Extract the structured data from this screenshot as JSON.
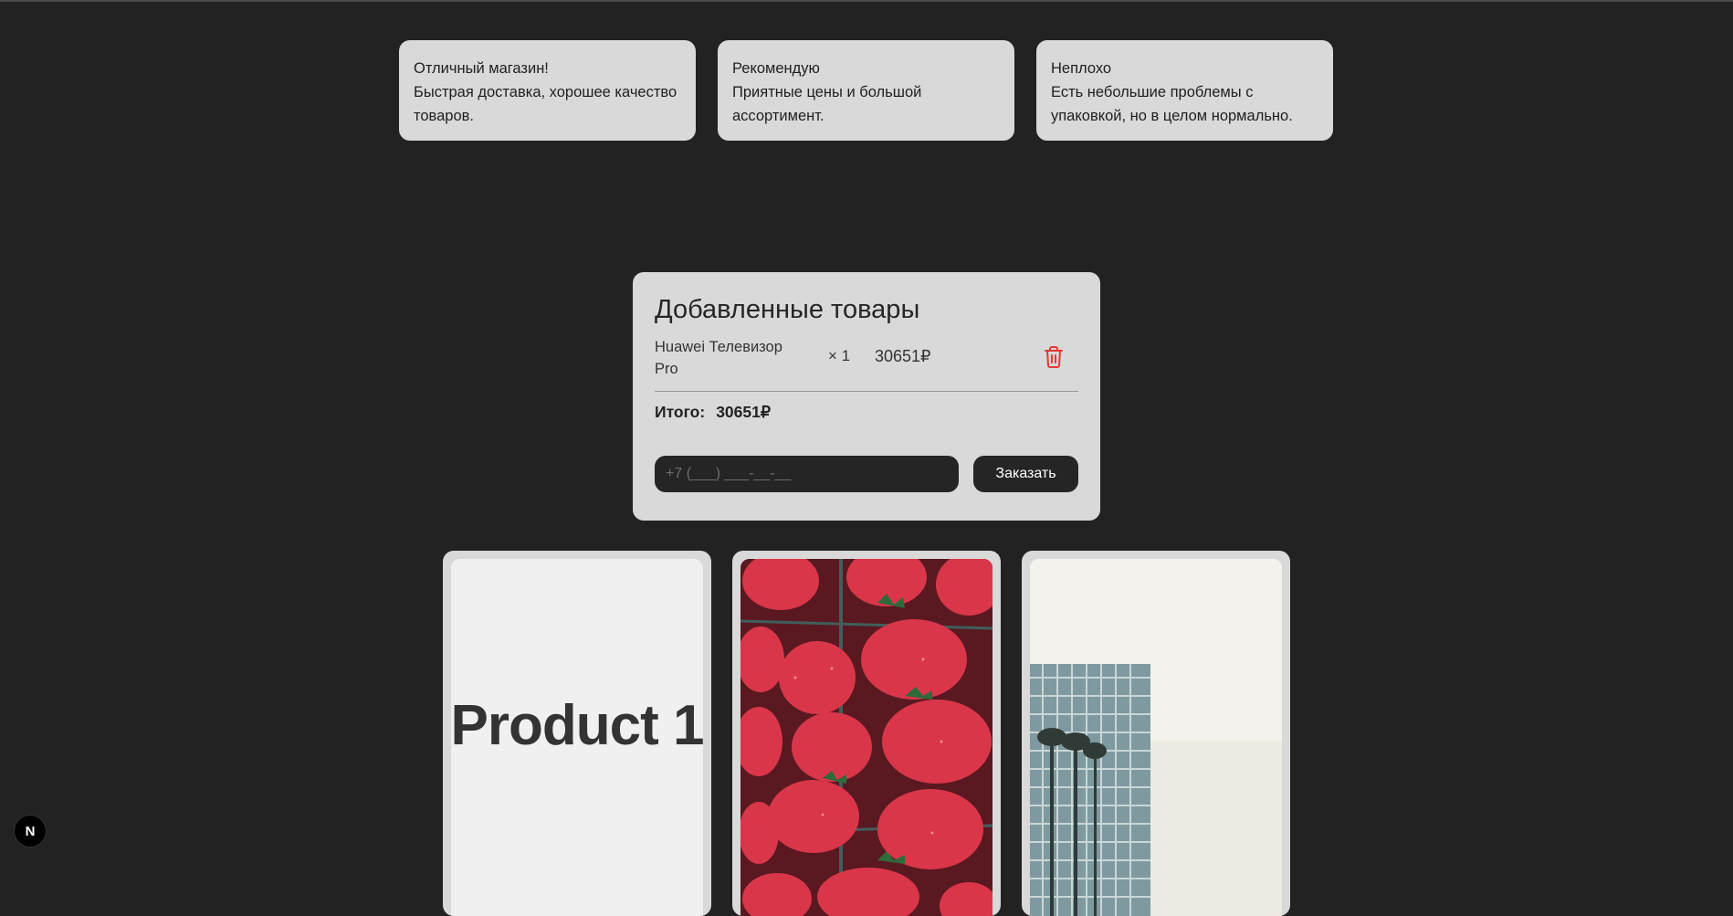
{
  "reviews": [
    {
      "title": "Отличный магазин!",
      "text": "Быстрая доставка, хорошее качество товаров."
    },
    {
      "title": "Рекомендую",
      "text": "Приятные цены и большой ассортимент."
    },
    {
      "title": "Неплохо",
      "text": "Есть небольшие проблемы с упаковкой, но в целом нормально."
    }
  ],
  "cart": {
    "title": "Добавленные товары",
    "items": [
      {
        "name": "Huawei Телевизор Pro",
        "qty": "× 1",
        "price": "30651₽",
        "remove_icon": "trash-icon"
      }
    ],
    "total_label": "Итого:",
    "total_value": "30651₽",
    "phone_placeholder": "+7 (___) ___-__-__",
    "order_button": "Заказать"
  },
  "products": [
    {
      "image_label": "Product 1"
    },
    {
      "image_label": ""
    },
    {
      "image_label": ""
    }
  ],
  "badge": {
    "label": "N"
  },
  "colors": {
    "background": "#222222",
    "card": "#d9d9d9",
    "accent_dark": "#252525",
    "delete_red": "#e53935"
  }
}
